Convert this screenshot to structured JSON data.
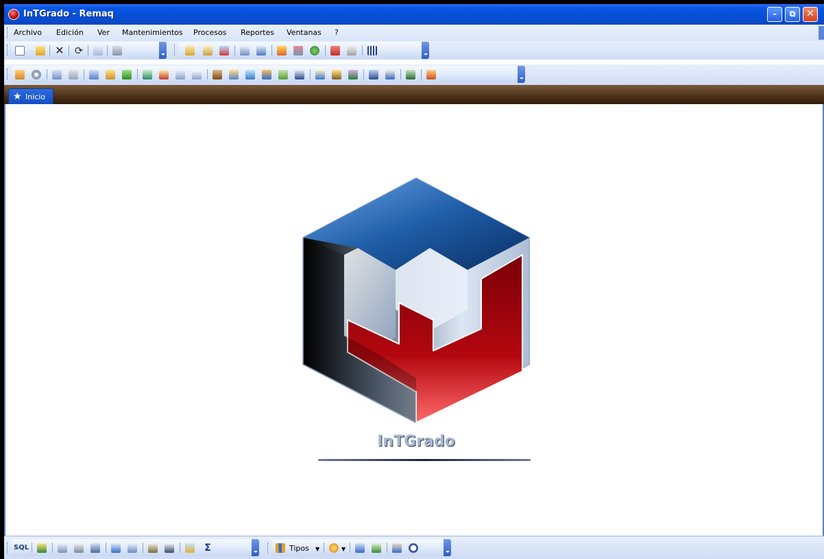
{
  "window": {
    "title": "InTGrado - Remaq",
    "buttons": {
      "minimize": "–",
      "maximize": "⧉",
      "close": "✕"
    }
  },
  "menu": {
    "items": [
      "Archivo",
      "Edición",
      "Ver",
      "Mantenimientos",
      "Procesos",
      "Reportes",
      "Ventanas",
      "?"
    ]
  },
  "tabs": [
    {
      "label": "Inicio",
      "icon": "star-icon"
    }
  ],
  "logo": {
    "text": "InTGrado",
    "colors": {
      "blue": "#1f5ea8",
      "red": "#b3070f",
      "steel": "#c9d6e8"
    }
  },
  "bottom_toolbar": {
    "sql_label": "SQL",
    "tipos_label": "Tipos"
  },
  "colors": {
    "titlebar": "#0b55e5",
    "menubar": "#dde8f9",
    "tabstrip": "#4a3018",
    "tab_active": "#1f5cd0"
  }
}
